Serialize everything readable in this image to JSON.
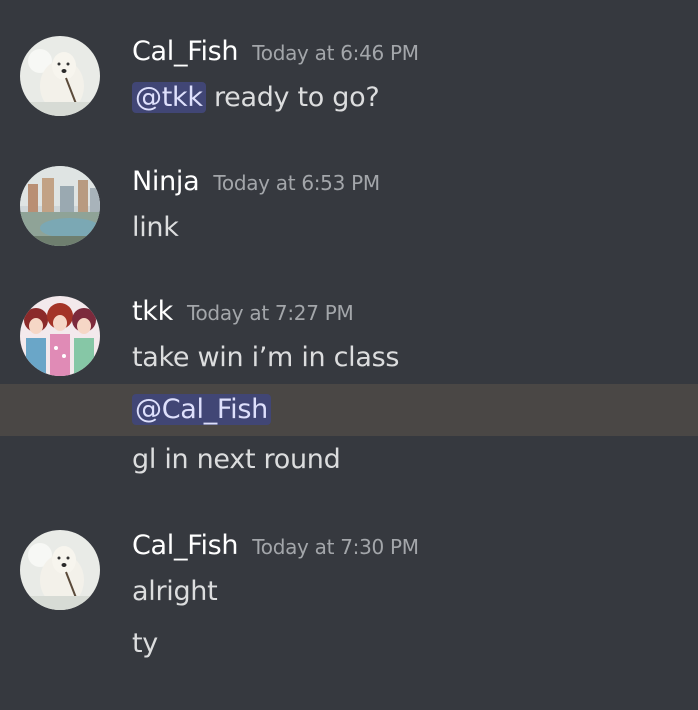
{
  "messages": [
    {
      "author": "Cal_Fish",
      "timestamp": "Today at 6:46 PM",
      "lines": [
        {
          "mention": "@tkk",
          "text": " ready to go?"
        }
      ]
    },
    {
      "author": "Ninja",
      "timestamp": "Today at 6:53 PM",
      "lines": [
        {
          "text": "link"
        }
      ]
    },
    {
      "author": "tkk",
      "timestamp": "Today at 7:27 PM",
      "lines": [
        {
          "text": "take win i’m in class"
        },
        {
          "mention": "@Cal_Fish",
          "highlighted": true
        },
        {
          "text": "gl in next round"
        }
      ]
    },
    {
      "author": "Cal_Fish",
      "timestamp": "Today at 7:30 PM",
      "lines": [
        {
          "text": "alright"
        },
        {
          "text": "ty"
        }
      ]
    }
  ],
  "colors": {
    "background": "#36393f",
    "username": "#ffffff",
    "timestamp": "#a3a6aa",
    "message_text": "#dcddde",
    "mention_bg": "#414675",
    "mention_text": "#dee0fc",
    "highlight_row": "#4a4745"
  },
  "icons": [
    "polar-bear-avatar-icon",
    "city-avatar-icon",
    "anime-girls-avatar-icon"
  ]
}
